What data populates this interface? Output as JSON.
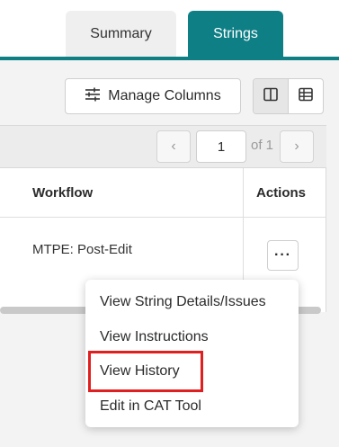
{
  "tabs": {
    "summary": "Summary",
    "strings": "Strings",
    "active": "Strings"
  },
  "toolbar": {
    "manage_columns": "Manage Columns",
    "manage_icon": "sliders-icon",
    "view_split_icon": "split-view-icon",
    "view_grid_icon": "grid-view-icon"
  },
  "pager": {
    "prev": "‹",
    "next": "›",
    "page_value": "1",
    "of_label": "of 1"
  },
  "table": {
    "columns": [
      "Workflow",
      "Actions"
    ],
    "rows": [
      {
        "workflow": "MTPE: Post-Edit",
        "actions": "···"
      }
    ]
  },
  "menu": {
    "items": [
      "View String Details/Issues",
      "View Instructions",
      "View History",
      "Edit in CAT Tool"
    ],
    "highlighted": "View History"
  },
  "colors": {
    "accent": "#0f7f86",
    "highlight": "#e02020"
  }
}
